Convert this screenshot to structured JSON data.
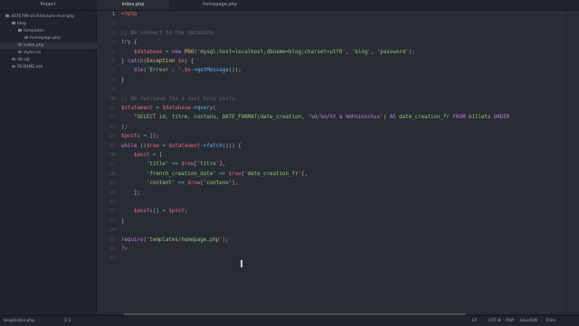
{
  "tabs": {
    "project": "Project",
    "file1": "index.php",
    "file2": "homepage.php"
  },
  "tree": [
    {
      "label": "4670799-architecture-mvc-php",
      "kind": "folder",
      "depth": 0
    },
    {
      "label": "blog",
      "kind": "folder",
      "depth": 1
    },
    {
      "label": "templates",
      "kind": "folder",
      "depth": 2
    },
    {
      "label": "homepage.php",
      "kind": "file",
      "depth": 3
    },
    {
      "label": "index.php",
      "kind": "file",
      "depth": 2,
      "selected": true
    },
    {
      "label": "style.css",
      "kind": "file",
      "depth": 2
    },
    {
      "label": "db.sql",
      "kind": "file",
      "depth": 1
    },
    {
      "label": "README.md",
      "kind": "file",
      "depth": 1
    }
  ],
  "lines": [
    [
      [
        "<?php",
        "tag"
      ]
    ],
    [],
    [
      [
        "// We connect to the database.",
        "cm"
      ]
    ],
    [
      [
        "try",
        "kw"
      ],
      [
        " {",
        "pl"
      ]
    ],
    [
      [
        "    ",
        "pl"
      ],
      [
        "$database",
        "var"
      ],
      [
        " = ",
        "op"
      ],
      [
        "new",
        "kw"
      ],
      [
        " ",
        "pl"
      ],
      [
        "PDO",
        "cls"
      ],
      [
        "(",
        "pl"
      ],
      [
        "'mysql:host=localhost;dbname=blog;charset=utf8'",
        "str"
      ],
      [
        ", ",
        "pl"
      ],
      [
        "'blog'",
        "str"
      ],
      [
        ", ",
        "pl"
      ],
      [
        "'password'",
        "str"
      ],
      [
        ");",
        "pl"
      ]
    ],
    [
      [
        "} ",
        "pl"
      ],
      [
        "catch",
        "kw"
      ],
      [
        "(",
        "pl"
      ],
      [
        "Exception",
        "cls"
      ],
      [
        " ",
        "pl"
      ],
      [
        "$e",
        "var"
      ],
      [
        ") {",
        "pl"
      ]
    ],
    [
      [
        "    ",
        "pl"
      ],
      [
        "die",
        "kw"
      ],
      [
        "(",
        "pl"
      ],
      [
        "'Erreur : '",
        "str"
      ],
      [
        ".",
        "op"
      ],
      [
        "$e",
        "var"
      ],
      [
        "->",
        "op"
      ],
      [
        "getMessage",
        "fn"
      ],
      [
        "());",
        "pl"
      ]
    ],
    [
      [
        "}",
        "pl"
      ]
    ],
    [],
    [
      [
        "// We retrieve the 5 last blog posts.",
        "cm"
      ]
    ],
    [
      [
        "$statement",
        "var"
      ],
      [
        " = ",
        "op"
      ],
      [
        "$database",
        "var"
      ],
      [
        "->",
        "op"
      ],
      [
        "query",
        "fn"
      ],
      [
        "(",
        "pl"
      ]
    ],
    [
      [
        "    ",
        "pl"
      ],
      [
        "\"SELECT id, titre, contenu, DATE_FORMAT(date_creation, '",
        "str"
      ],
      [
        "%d/%m/%Y à %Hh%imin%ss",
        "kw"
      ],
      [
        "') ",
        "str"
      ],
      [
        "AS",
        "kw"
      ],
      [
        " date_creation_fr ",
        "str"
      ],
      [
        "FROM",
        "kw"
      ],
      [
        " billets ",
        "str"
      ],
      [
        "ORDER",
        "kw"
      ]
    ],
    [
      [
        ");",
        "pl"
      ]
    ],
    [
      [
        "$posts",
        "var"
      ],
      [
        " = ",
        "op"
      ],
      [
        "[];",
        "pl"
      ]
    ],
    [
      [
        "while",
        "kw"
      ],
      [
        " ((",
        "pl"
      ],
      [
        "$row",
        "var"
      ],
      [
        " = ",
        "op"
      ],
      [
        "$statement",
        "var"
      ],
      [
        "->",
        "op"
      ],
      [
        "fetch",
        "fn"
      ],
      [
        "())) {",
        "pl"
      ]
    ],
    [
      [
        "    ",
        "pl"
      ],
      [
        "$post",
        "var"
      ],
      [
        " = ",
        "op"
      ],
      [
        "[",
        "pl"
      ]
    ],
    [
      [
        "        ",
        "pl"
      ],
      [
        "'title'",
        "str"
      ],
      [
        " => ",
        "op"
      ],
      [
        "$row",
        "var"
      ],
      [
        "[",
        "pl"
      ],
      [
        "'titre'",
        "str"
      ],
      [
        "],",
        "pl"
      ]
    ],
    [
      [
        "        ",
        "pl"
      ],
      [
        "'french_creation_date'",
        "str"
      ],
      [
        " => ",
        "op"
      ],
      [
        "$row",
        "var"
      ],
      [
        "[",
        "pl"
      ],
      [
        "'date_creation_fr'",
        "str"
      ],
      [
        "],",
        "pl"
      ]
    ],
    [
      [
        "        ",
        "pl"
      ],
      [
        "'content'",
        "str"
      ],
      [
        " => ",
        "op"
      ],
      [
        "$row",
        "var"
      ],
      [
        "[",
        "pl"
      ],
      [
        "'contenu'",
        "str"
      ],
      [
        "],",
        "pl"
      ]
    ],
    [
      [
        "    ",
        "pl"
      ],
      [
        "];",
        "pl"
      ]
    ],
    [],
    [
      [
        "    ",
        "pl"
      ],
      [
        "$posts",
        "var"
      ],
      [
        "[] = ",
        "op"
      ],
      [
        "$post",
        "var"
      ],
      [
        ";",
        "pl"
      ]
    ],
    [
      [
        "}",
        "pl"
      ]
    ],
    [],
    [
      [
        "require",
        "kw"
      ],
      [
        "(",
        "pl"
      ],
      [
        "'templates/homepage.php'",
        "str"
      ],
      [
        ");",
        "pl"
      ]
    ],
    [
      [
        "?>",
        "tag"
      ]
    ],
    []
  ],
  "status": {
    "path": "blog/index.php",
    "position": "1:1",
    "lf": "LF",
    "encoding": "UTF-8",
    "grammar": "PHP",
    "branch": "blue/SW",
    "files": "Files"
  },
  "colors": {
    "background": "#282c34",
    "keyword": "#c678dd",
    "variable": "#e06c75",
    "function": "#61afef",
    "string": "#98c379",
    "comment": "#5c6370"
  }
}
